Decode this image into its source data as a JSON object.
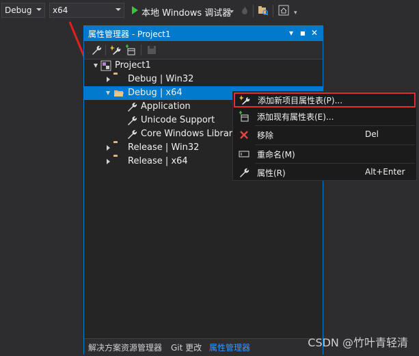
{
  "toolbar": {
    "config_value": "Debug",
    "platform_value": "x64",
    "run_label": "本地 Windows 调试器"
  },
  "panel": {
    "title": "属性管理器 - Project1",
    "controls": [
      "▾",
      "■",
      "✕"
    ],
    "tree": [
      {
        "label": "Project1",
        "level": 0,
        "expander": "open"
      },
      {
        "label": "Debug | Win32",
        "level": 1,
        "expander": "closed"
      },
      {
        "label": "Debug | x64",
        "level": 1,
        "expander": "open",
        "selected": true
      },
      {
        "label": "Application",
        "level": 2,
        "expander": "none"
      },
      {
        "label": "Unicode Support",
        "level": 2,
        "expander": "none"
      },
      {
        "label": "Core Windows Libraries",
        "level": 2,
        "expander": "none"
      },
      {
        "label": "Release | Win32",
        "level": 1,
        "expander": "closed"
      },
      {
        "label": "Release | x64",
        "level": 1,
        "expander": "closed"
      }
    ],
    "tabs": [
      {
        "label": "解决方案资源管理器"
      },
      {
        "label": "Git 更改"
      },
      {
        "label": "属性管理器",
        "active": true
      }
    ]
  },
  "context_menu": {
    "items": [
      {
        "label": "添加新项目属性表(P)...",
        "shortcut": "",
        "icon": "add-new-sheet-icon",
        "highlighted": true
      },
      {
        "label": "添加现有属性表(E)...",
        "shortcut": "",
        "icon": "add-existing-sheet-icon"
      },
      {
        "label": "移除",
        "shortcut": "Del",
        "icon": "remove-x-icon"
      },
      {
        "label": "重命名(M)",
        "shortcut": "",
        "icon": "rename-icon"
      },
      {
        "label": "属性(R)",
        "shortcut": "Alt+Enter",
        "icon": "wrench-icon"
      }
    ]
  },
  "watermark": "CSDN @竹叶青轻清",
  "colors": {
    "accent": "#007acc",
    "background": "#2d2d30",
    "highlight_border": "#e03030",
    "arrow": "#e02020"
  }
}
